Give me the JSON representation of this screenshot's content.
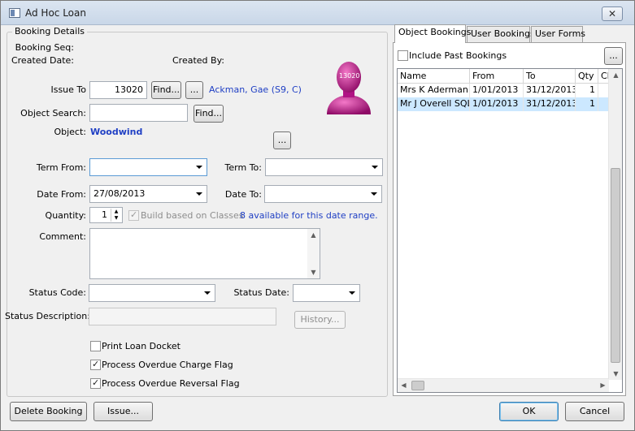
{
  "window": {
    "title": "Ad Hoc Loan",
    "close_label": "✕"
  },
  "booking_details": {
    "group_title": "Booking Details",
    "booking_seq_label": "Booking Seq:",
    "created_date_label": "Created Date:",
    "created_by_label": "Created By:",
    "issue_to_label": "Issue To",
    "issue_to_value": "13020",
    "find_label": "Find...",
    "ellipsis_label": "...",
    "issue_to_name": "Ackman, Gae (S9, C)",
    "avatar_id": "13020",
    "object_search_label": "Object Search:",
    "object_search_value": "",
    "object_find_label": "Find...",
    "object_label": "Object:",
    "object_value": "Woodwind",
    "object_ellipsis_label": "...",
    "term_from_label": "Term From:",
    "term_from_value": "",
    "term_to_label": "Term To:",
    "term_to_value": "",
    "date_from_label": "Date From:",
    "date_from_value": "27/08/2013",
    "date_to_label": "Date To:",
    "date_to_value": "",
    "quantity_label": "Quantity:",
    "quantity_value": "1",
    "build_label": "Build based on Classes",
    "available_text": "8 available for this date range.",
    "comment_label": "Comment:",
    "comment_value": "",
    "status_code_label": "Status Code:",
    "status_code_value": "",
    "status_date_label": "Status Date:",
    "status_date_value": "",
    "status_desc_label": "Status Description:",
    "status_desc_value": "",
    "history_label": "History...",
    "print_docket_label": "Print Loan Docket",
    "overdue_charge_label": "Process Overdue Charge Flag",
    "overdue_reversal_label": "Process Overdue Reversal Flag"
  },
  "right_panel": {
    "tabs": [
      {
        "label": "Object Bookings"
      },
      {
        "label": "User Bookings"
      },
      {
        "label": "User Forms"
      }
    ],
    "include_past_label": "Include Past Bookings",
    "ellipsis_label": "...",
    "columns": [
      "Name",
      "From",
      "To",
      "Qty",
      "Cla"
    ],
    "rows": [
      {
        "name": "Mrs K Aderman",
        "from": "1/01/2013",
        "to": "31/12/2013",
        "qty": "1"
      },
      {
        "name": "Mr J Overell SQL",
        "from": "1/01/2013",
        "to": "31/12/2013",
        "qty": "1"
      }
    ]
  },
  "footer": {
    "delete_label": "Delete Booking",
    "issue_label": "Issue...",
    "ok_label": "OK",
    "cancel_label": "Cancel"
  },
  "colors": {
    "link": "#1f3fc4",
    "avatar": "#c0168f",
    "selection": "#cce8ff"
  }
}
